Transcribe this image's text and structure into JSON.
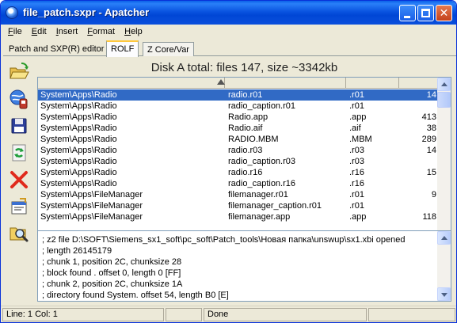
{
  "window": {
    "title": "file_patch.sxpr - Apatcher",
    "buttons": {
      "minimize": "minimize",
      "maximize": "maximize",
      "close": "✕"
    }
  },
  "menu": [
    {
      "label": "File"
    },
    {
      "label": "Edit"
    },
    {
      "label": "Insert"
    },
    {
      "label": "Format"
    },
    {
      "label": "Help"
    }
  ],
  "tabs": [
    {
      "label": "Patch and SXP(R) editor"
    },
    {
      "label": "ROLF",
      "active": true
    },
    {
      "label": "Z Core/Var"
    }
  ],
  "toolbar": [
    {
      "icon": "open-folder-icon"
    },
    {
      "icon": "globe-device-icon"
    },
    {
      "icon": "save-disk-icon"
    },
    {
      "icon": "refresh-icon"
    },
    {
      "icon": "delete-x-icon"
    },
    {
      "icon": "properties-icon"
    },
    {
      "icon": "search-icon"
    }
  ],
  "disk": {
    "title": "Disk A total: files 147, size ~3342kb"
  },
  "files": [
    {
      "path": "System\\Apps\\Radio",
      "name": "radio.r01",
      "ext": ".r01",
      "size": "14",
      "selected": true
    },
    {
      "path": "System\\Apps\\Radio",
      "name": "radio_caption.r01",
      "ext": ".r01",
      "size": ""
    },
    {
      "path": "System\\Apps\\Radio",
      "name": "Radio.app",
      "ext": ".app",
      "size": "413"
    },
    {
      "path": "System\\Apps\\Radio",
      "name": "Radio.aif",
      "ext": ".aif",
      "size": "38"
    },
    {
      "path": "System\\Apps\\Radio",
      "name": "RADIO.MBM",
      "ext": ".MBM",
      "size": "289"
    },
    {
      "path": "System\\Apps\\Radio",
      "name": "radio.r03",
      "ext": ".r03",
      "size": "14"
    },
    {
      "path": "System\\Apps\\Radio",
      "name": "radio_caption.r03",
      "ext": ".r03",
      "size": ""
    },
    {
      "path": "System\\Apps\\Radio",
      "name": "radio.r16",
      "ext": ".r16",
      "size": "15"
    },
    {
      "path": "System\\Apps\\Radio",
      "name": "radio_caption.r16",
      "ext": ".r16",
      "size": ""
    },
    {
      "path": "System\\Apps\\FileManager",
      "name": "filemanager.r01",
      "ext": ".r01",
      "size": "9"
    },
    {
      "path": "System\\Apps\\FileManager",
      "name": "filemanager_caption.r01",
      "ext": ".r01",
      "size": ""
    },
    {
      "path": "System\\Apps\\FileManager",
      "name": "filemanager.app",
      "ext": ".app",
      "size": "118"
    }
  ],
  "log": [
    "; z2 file D:\\SOFT\\Siemens_sx1_soft\\pc_soft\\Patch_tools\\Новая папка\\unswup\\sx1.xbi opened",
    "; length 26145179",
    "; chunk 1, position 2C, chunksize 28",
    "; block found . offset 0, length 0 [FF]",
    "; chunk 2, position 2C, chunksize 1A",
    "; directory found System. offset 54, length B0 [E]"
  ],
  "status": {
    "position": "Line:   1  Col:   1",
    "message": "Done",
    "extra": "",
    "right": ""
  },
  "colors": {
    "selection": "#316ac5",
    "titlebar": "#0a54e0",
    "face": "#ece9d8"
  }
}
